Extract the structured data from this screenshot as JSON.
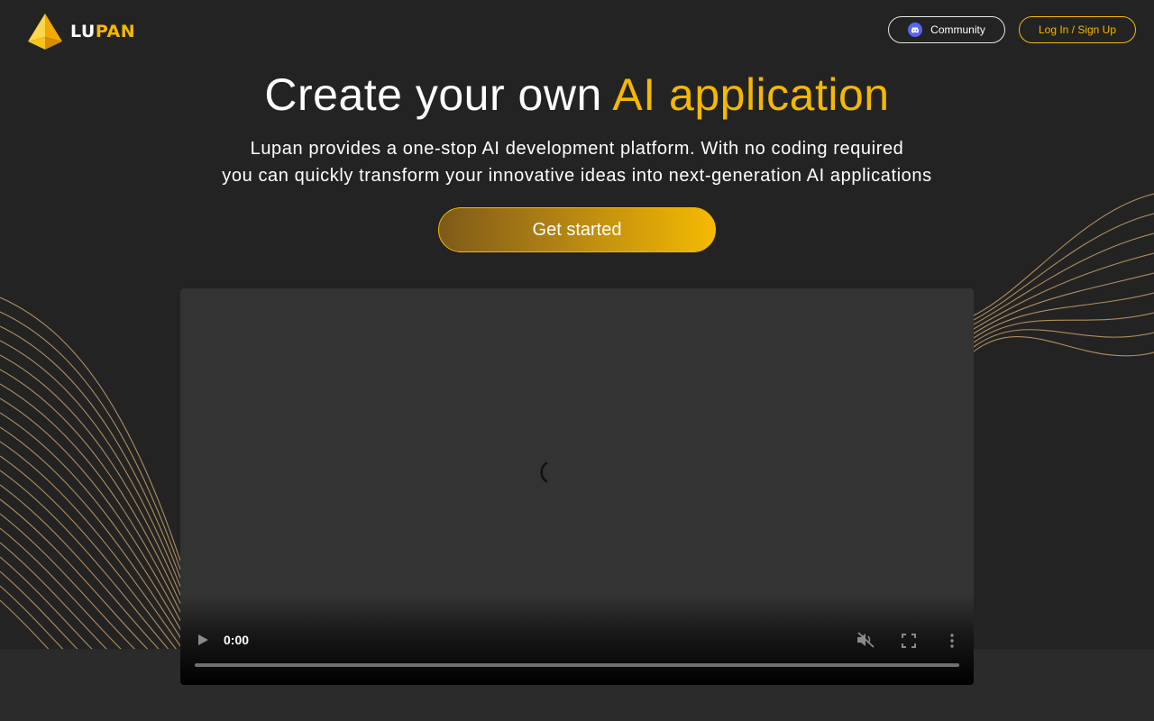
{
  "brand": {
    "name_part1": "LU",
    "name_part2": "PAN",
    "primary_color": "#f5b800",
    "background_color": "#232323"
  },
  "header": {
    "community_label": "Community",
    "community_icon": "discord-icon",
    "login_label": "Log In / Sign Up"
  },
  "hero": {
    "title_plain": "Create your own ",
    "title_accent": "AI application",
    "subtitle_line1": "Lupan provides a one-stop AI development platform. With no coding required",
    "subtitle_line2": "you can quickly transform your innovative ideas into next-generation AI applications",
    "cta_label": "Get started"
  },
  "video": {
    "current_time": "0:00",
    "state": "loading",
    "muted": true,
    "progress": 0,
    "controls": [
      "play-icon",
      "mute-icon",
      "fullscreen-icon",
      "more-options-icon"
    ]
  }
}
